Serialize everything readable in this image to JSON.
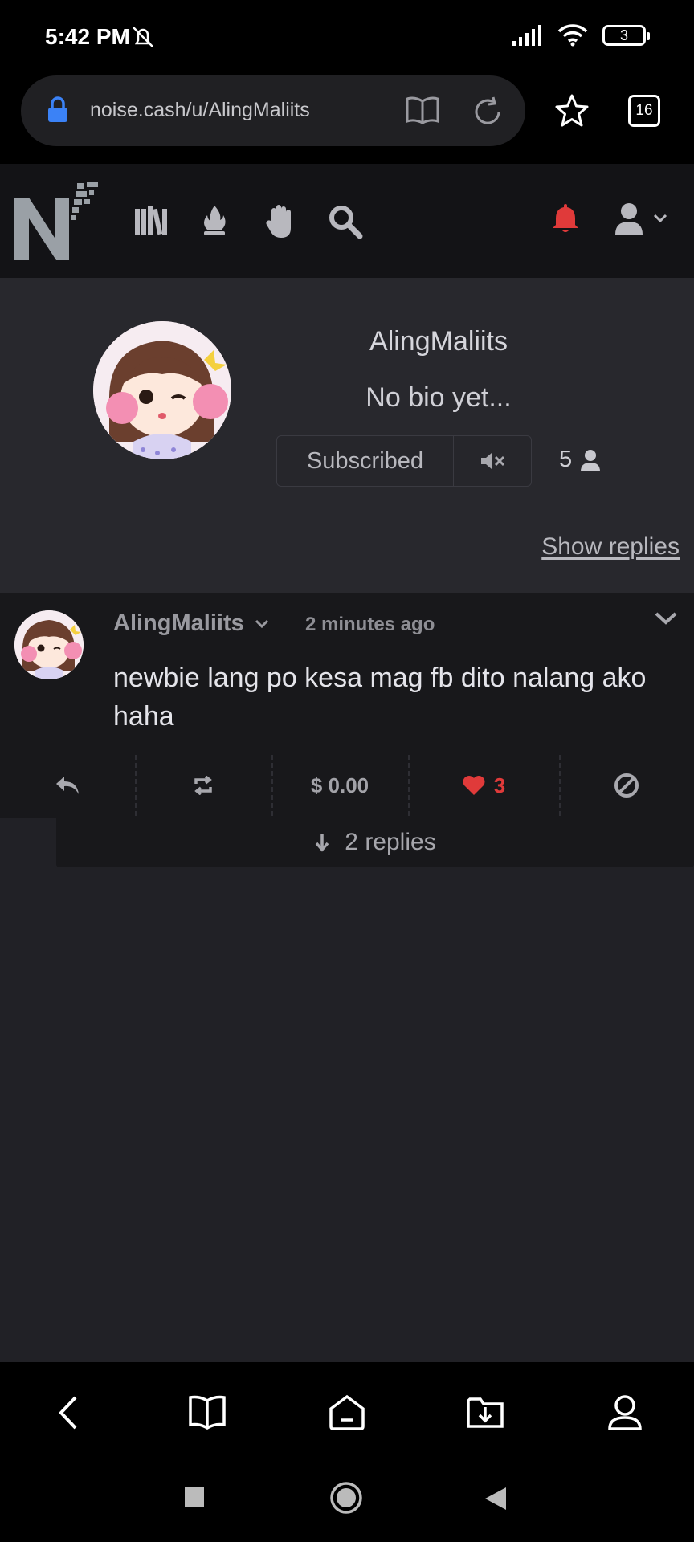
{
  "status_bar": {
    "time": "5:42 PM",
    "battery": "3"
  },
  "browser": {
    "url": "noise.cash/u/AlingMaliits",
    "tab_count": "16"
  },
  "profile": {
    "username": "AlingMaliits",
    "bio": "No bio yet...",
    "subscribe_label": "Subscribed",
    "subscriber_count": "5",
    "show_replies": "Show replies"
  },
  "post": {
    "author": "AlingMaliits",
    "time": "2 minutes ago",
    "text": "newbie lang po kesa mag fb dito nalang ako haha",
    "tip_amount": "$ 0.00",
    "like_count": "3",
    "replies_label": "2 replies"
  },
  "colors": {
    "accent_red": "#e03a3a",
    "link_blue": "#3b82f6"
  },
  "icons": [
    "lock-icon",
    "reader-mode-icon",
    "reload-icon",
    "star-icon",
    "tabs-icon",
    "library-icon",
    "fire-icon",
    "hand-icon",
    "search-icon",
    "bell-icon",
    "user-icon",
    "chevron-down-icon",
    "mute-icon",
    "reply-icon",
    "repost-icon",
    "heart-icon",
    "block-icon",
    "arrow-down-icon",
    "back-icon",
    "bookmarks-icon",
    "home-icon",
    "downloads-icon",
    "account-icon"
  ]
}
